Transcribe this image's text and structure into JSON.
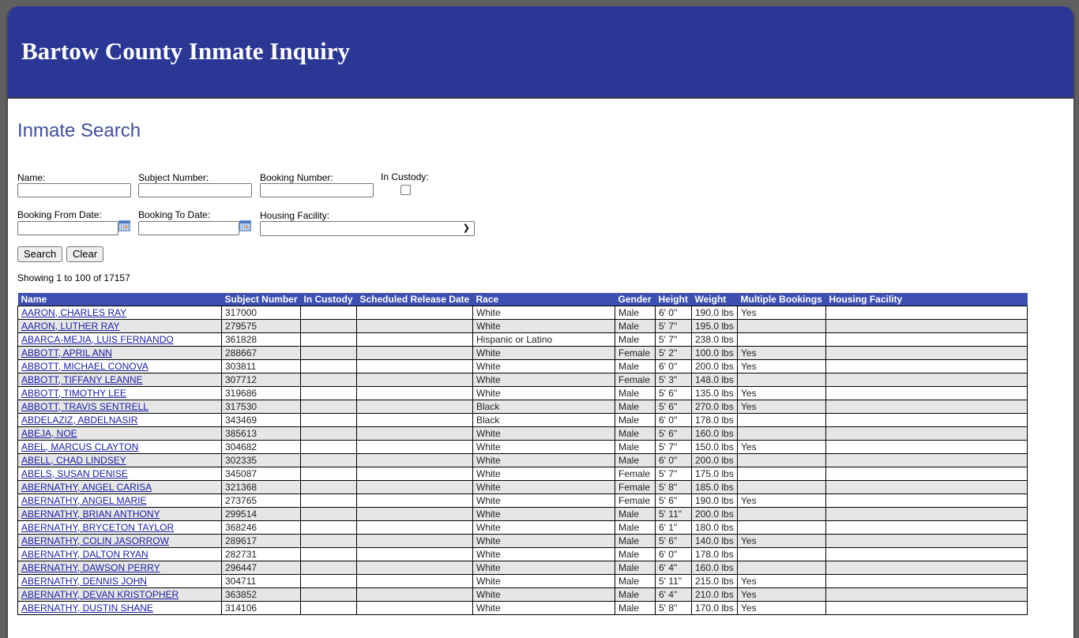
{
  "header": {
    "title": "Bartow County Inmate Inquiry"
  },
  "search": {
    "title": "Inmate Search",
    "name_label": "Name:",
    "name_value": "",
    "subject_label": "Subject Number:",
    "subject_value": "",
    "booking_label": "Booking Number:",
    "booking_value": "",
    "custody_label": "In Custody:",
    "custody_checked": false,
    "from_label": "Booking From Date:",
    "from_value": "",
    "to_label": "Booking To Date:",
    "to_value": "",
    "facility_label": "Housing Facility:",
    "facility_value": "",
    "search_button": "Search",
    "clear_button": "Clear"
  },
  "results": {
    "showing": "Showing 1 to 100 of 17157",
    "columns": [
      "Name",
      "Subject Number",
      "In Custody",
      "Scheduled Release Date",
      "Race",
      "Gender",
      "Height",
      "Weight",
      "Multiple Bookings",
      "Housing Facility"
    ],
    "rows": [
      [
        "AARON, CHARLES RAY",
        "317000",
        "",
        "",
        "White",
        "Male",
        "6' 0\"",
        "190.0 lbs",
        "Yes",
        ""
      ],
      [
        "AARON, LUTHER RAY",
        "279575",
        "",
        "",
        "White",
        "Male",
        "5' 7\"",
        "195.0 lbs",
        "",
        ""
      ],
      [
        "ABARCA-MEJIA, LUIS FERNANDO",
        "361828",
        "",
        "",
        "Hispanic or Latino",
        "Male",
        "5' 7\"",
        "238.0 lbs",
        "",
        ""
      ],
      [
        "ABBOTT, APRIL ANN",
        "288667",
        "",
        "",
        "White",
        "Female",
        "5' 2\"",
        "100.0 lbs",
        "Yes",
        ""
      ],
      [
        "ABBOTT, MICHAEL CONOVA",
        "303811",
        "",
        "",
        "White",
        "Male",
        "6' 0\"",
        "200.0 lbs",
        "Yes",
        ""
      ],
      [
        "ABBOTT, TIFFANY LEANNE",
        "307712",
        "",
        "",
        "White",
        "Female",
        "5' 3\"",
        "148.0 lbs",
        "",
        ""
      ],
      [
        "ABBOTT, TIMOTHY LEE",
        "319686",
        "",
        "",
        "White",
        "Male",
        "5' 6\"",
        "135.0 lbs",
        "Yes",
        ""
      ],
      [
        "ABBOTT, TRAVIS SENTRELL",
        "317530",
        "",
        "",
        "Black",
        "Male",
        "5' 6\"",
        "270.0 lbs",
        "Yes",
        ""
      ],
      [
        "ABDELAZIZ, ABDELNASIR",
        "343469",
        "",
        "",
        "Black",
        "Male",
        "6' 0\"",
        "178.0 lbs",
        "",
        ""
      ],
      [
        "ABEJA, NOE",
        "385613",
        "",
        "",
        "White",
        "Male",
        "5' 6\"",
        "160.0 lbs",
        "",
        ""
      ],
      [
        "ABEL, MARCUS CLAYTON",
        "304682",
        "",
        "",
        "White",
        "Male",
        "5' 7\"",
        "150.0 lbs",
        "Yes",
        ""
      ],
      [
        "ABELL, CHAD LINDSEY",
        "302335",
        "",
        "",
        "White",
        "Male",
        "6' 0\"",
        "200.0 lbs",
        "",
        ""
      ],
      [
        "ABELS, SUSAN DENISE",
        "345087",
        "",
        "",
        "White",
        "Female",
        "5' 7\"",
        "175.0 lbs",
        "",
        ""
      ],
      [
        "ABERNATHY, ANGEL CARISA",
        "321368",
        "",
        "",
        "White",
        "Female",
        "5' 8\"",
        "185.0 lbs",
        "",
        ""
      ],
      [
        "ABERNATHY, ANGEL MARIE",
        "273765",
        "",
        "",
        "White",
        "Female",
        "5' 6\"",
        "190.0 lbs",
        "Yes",
        ""
      ],
      [
        "ABERNATHY, BRIAN ANTHONY",
        "299514",
        "",
        "",
        "White",
        "Male",
        "5' 11\"",
        "200.0 lbs",
        "",
        ""
      ],
      [
        "ABERNATHY, BRYCETON TAYLOR",
        "368246",
        "",
        "",
        "White",
        "Male",
        "6' 1\"",
        "180.0 lbs",
        "",
        ""
      ],
      [
        "ABERNATHY, COLIN JASORROW",
        "289617",
        "",
        "",
        "White",
        "Male",
        "5' 6\"",
        "140.0 lbs",
        "Yes",
        ""
      ],
      [
        "ABERNATHY, DALTON RYAN",
        "282731",
        "",
        "",
        "White",
        "Male",
        "6' 0\"",
        "178.0 lbs",
        "",
        ""
      ],
      [
        "ABERNATHY, DAWSON PERRY",
        "296447",
        "",
        "",
        "White",
        "Male",
        "6' 4\"",
        "160.0 lbs",
        "",
        ""
      ],
      [
        "ABERNATHY, DENNIS JOHN",
        "304711",
        "",
        "",
        "White",
        "Male",
        "5' 11\"",
        "215.0 lbs",
        "Yes",
        ""
      ],
      [
        "ABERNATHY, DEVAN KRISTOPHER",
        "363852",
        "",
        "",
        "White",
        "Male",
        "6' 4\"",
        "210.0 lbs",
        "Yes",
        ""
      ],
      [
        "ABERNATHY, DUSTIN SHANE",
        "314106",
        "",
        "",
        "White",
        "Male",
        "5' 8\"",
        "170.0 lbs",
        "Yes",
        ""
      ]
    ]
  }
}
